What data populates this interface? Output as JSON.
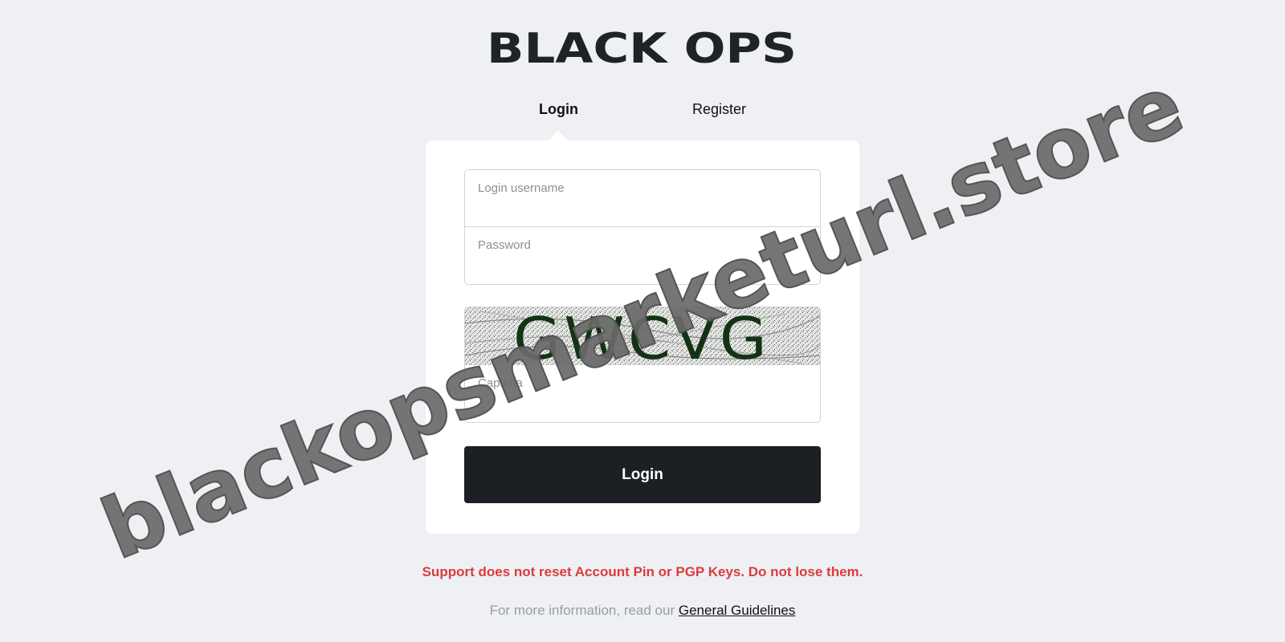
{
  "logo": {
    "text": "BLACK OPS"
  },
  "tabs": [
    {
      "label": "Login",
      "active": true
    },
    {
      "label": "Register",
      "active": false
    }
  ],
  "form": {
    "username_placeholder": "Login username",
    "password_placeholder": "Password",
    "captcha_text": "GWCVG",
    "captcha_placeholder": "Captcha",
    "submit_label": "Login"
  },
  "warning": "Support does not reset Account Pin or PGP Keys. Do not lose them.",
  "info": {
    "prefix": "For more information, read our ",
    "link_label": "General Guidelines"
  },
  "watermark": "blackopsmarketurl.store",
  "colors": {
    "background": "#eef0f4",
    "button": "#1c1f23",
    "warning": "#dc3b3b",
    "logo_dark": "#1f2227",
    "logo_light": "#363b42"
  }
}
